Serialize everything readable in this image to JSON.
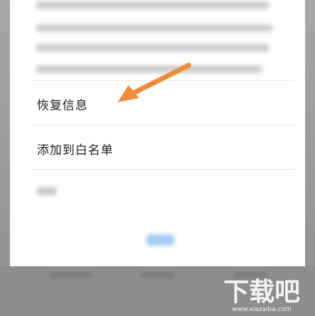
{
  "menu": {
    "items": [
      {
        "label": "恢复信息"
      },
      {
        "label": "添加到白名单"
      }
    ]
  },
  "watermark": {
    "main": "下载吧",
    "sub": "www.xiazaiba.com"
  },
  "colors": {
    "arrow": "#f08b3a",
    "dialog_background": "#ffffff",
    "overlay": "#9c9c9c",
    "primary_button": "#a5cdf2"
  }
}
